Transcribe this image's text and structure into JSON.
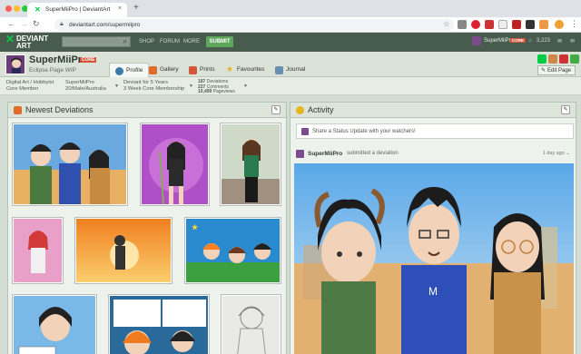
{
  "browser": {
    "tab_title": "SuperMiiPro | DeviantArt",
    "url": "deviantart.com/supermiipro"
  },
  "header": {
    "logo_line1": "DEVIANT",
    "logo_line2": "ART",
    "nav": [
      "SHOP",
      "FORUM",
      "MORE"
    ],
    "submit_label": "SUBMIT",
    "username": "SuperMiiPro",
    "user_badge": "CORE",
    "points": "3,223"
  },
  "profile": {
    "name": "SuperMiiPro",
    "badge": "CORE",
    "tagline": "Eclipse Page WIP",
    "tabs": [
      "Profile",
      "Gallery",
      "Prints",
      "Favourites",
      "Journal"
    ],
    "edit_label": "Edit Page"
  },
  "stats": {
    "role_line1": "Digital Art / Hobbyist",
    "role_line2": "Core Member",
    "info_line1": "SuperMiiPro",
    "info_line2": "20/Male/Australia",
    "member_line1": "Deviant for 5 Years",
    "member_line2": "3 Week Core Membership",
    "dev_count": "187",
    "dev_label": "Deviations",
    "com_count": "227",
    "com_label": "Comments",
    "pv_count": "10,499",
    "pv_label": "Pageviews"
  },
  "newest": {
    "title": "Newest Deviations"
  },
  "activity": {
    "title": "Activity",
    "status_prompt": "Share a Status Update with your watchers!",
    "feed_user": "SuperMiiPro",
    "feed_action": "submitted a deviation",
    "feed_time": "1 day ago"
  },
  "colors": {
    "header_bg": "#475c4d",
    "accent_green": "#05cc47",
    "core_red": "#d4563a"
  }
}
